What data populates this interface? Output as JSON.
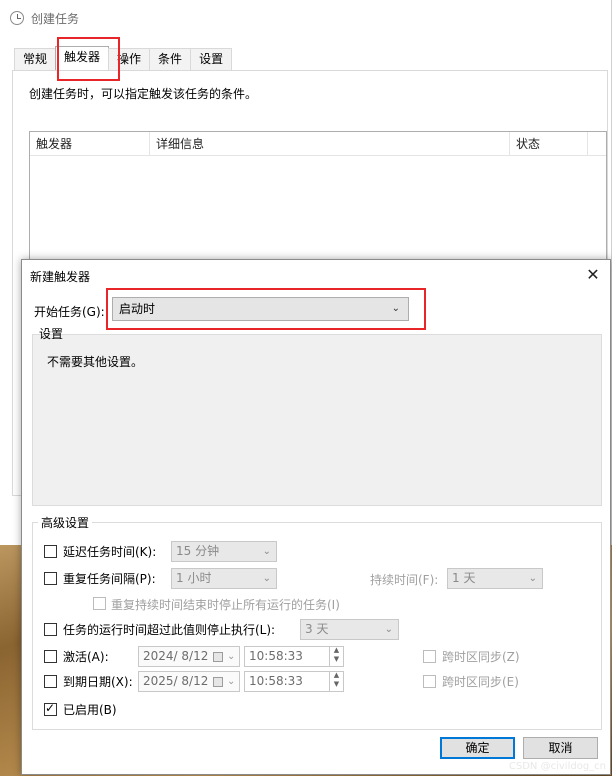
{
  "background_window": {
    "title": "创建任务",
    "tabs": [
      "常规",
      "触发器",
      "操作",
      "条件",
      "设置"
    ],
    "active_tab": "触发器",
    "description": "创建任务时，可以指定触发该任务的条件。",
    "columns": [
      "触发器",
      "详细信息",
      "状态"
    ]
  },
  "dialog": {
    "title": "新建触发器",
    "close_label": "✕",
    "start_task_label": "开始任务(G):",
    "start_task_value": "启动时",
    "settings_label": "设置",
    "settings_text": "不需要其他设置。",
    "advanced_label": "高级设置",
    "delay": {
      "label": "延迟任务时间(K):",
      "value": "15 分钟",
      "checked": false
    },
    "repeat": {
      "label": "重复任务间隔(P):",
      "value": "1 小时",
      "checked": false
    },
    "duration": {
      "label": "持续时间(F):",
      "value": "1 天"
    },
    "stop_all": {
      "label": "重复持续时间结束时停止所有运行的任务(I)",
      "checked": false
    },
    "stop_if_longer": {
      "label": "任务的运行时间超过此值则停止执行(L):",
      "value": "3 天",
      "checked": false
    },
    "activate": {
      "label": "激活(A):",
      "date": "2024/  8/12",
      "time": "10:58:33",
      "checked": false
    },
    "expire": {
      "label": "到期日期(X):",
      "date": "2025/  8/12",
      "time": "10:58:33",
      "checked": false
    },
    "sync_tz_activate": "跨时区同步(Z)",
    "sync_tz_expire": "跨时区同步(E)",
    "enabled": {
      "label": "已启用(B)",
      "checked": true
    },
    "ok_label": "确定",
    "cancel_label": "取消"
  },
  "watermark": "CSDN @civildog_cn",
  "colors": {
    "highlight": "#e8262a",
    "accent": "#0078d7"
  }
}
